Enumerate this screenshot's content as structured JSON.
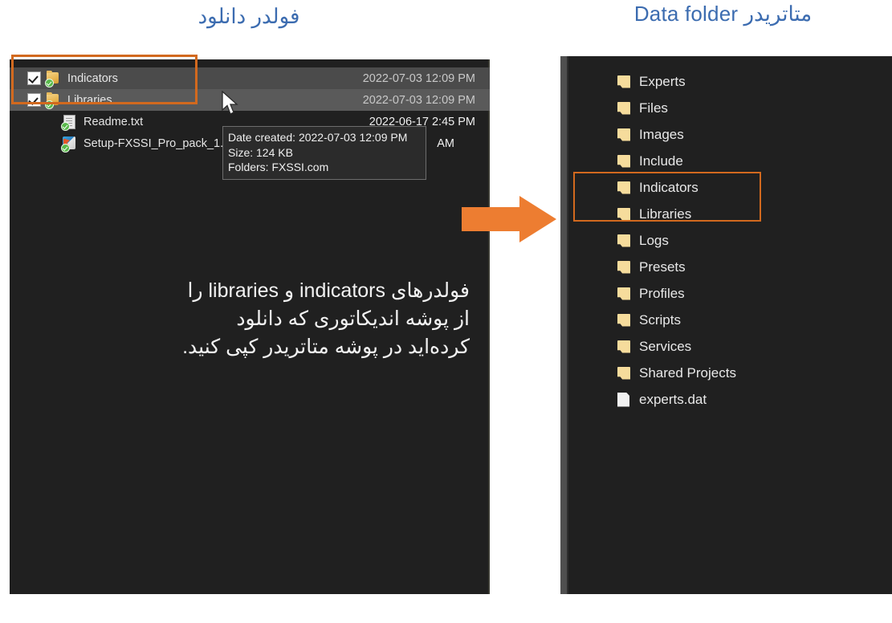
{
  "headings": {
    "left": "فولدر دانلود",
    "right": "متاتریدر Data folder"
  },
  "colors": {
    "heading_blue": "#3c6cb0",
    "highlight_orange": "#d2691e",
    "arrow_orange": "#ed7d31",
    "panel_background": "#202020",
    "folder_yellow": "#f6dc9c"
  },
  "download_folder": {
    "rows": [
      {
        "name": "Indicators",
        "date": "2022-07-03 12:09 PM",
        "icon": "folder-icon",
        "checked": true,
        "selected": "strong"
      },
      {
        "name": "Libraries",
        "date": "2022-07-03 12:09 PM",
        "icon": "folder-icon",
        "checked": true,
        "selected": "light"
      },
      {
        "name": "Readme.txt",
        "date": "2022-06-17 2:45 PM",
        "icon": "text-file-icon",
        "checked": false,
        "selected": "none"
      },
      {
        "name": "Setup-FXSSI_Pro_pack_1.086.e",
        "date": "AM",
        "icon": "setup-exe-icon",
        "checked": false,
        "selected": "none"
      }
    ],
    "tooltip": {
      "date_created": "Date created: 2022-07-03 12:09 PM",
      "size": "Size: 124 KB",
      "folders": "Folders: FXSSI.com"
    }
  },
  "metatrader_data_folder": {
    "items": [
      {
        "name": "Experts",
        "icon": "folder-icon",
        "highlighted": false
      },
      {
        "name": "Files",
        "icon": "folder-icon",
        "highlighted": false
      },
      {
        "name": "Images",
        "icon": "folder-icon",
        "highlighted": false
      },
      {
        "name": "Include",
        "icon": "folder-icon",
        "highlighted": false
      },
      {
        "name": "Indicators",
        "icon": "folder-icon",
        "highlighted": true
      },
      {
        "name": "Libraries",
        "icon": "folder-icon",
        "highlighted": true
      },
      {
        "name": "Logs",
        "icon": "folder-icon",
        "highlighted": false
      },
      {
        "name": "Presets",
        "icon": "folder-icon",
        "highlighted": false
      },
      {
        "name": "Profiles",
        "icon": "folder-icon",
        "highlighted": false
      },
      {
        "name": "Scripts",
        "icon": "folder-icon",
        "highlighted": false
      },
      {
        "name": "Services",
        "icon": "folder-icon",
        "highlighted": false
      },
      {
        "name": "Shared Projects",
        "icon": "folder-icon",
        "highlighted": false
      },
      {
        "name": "experts.dat",
        "icon": "file-icon",
        "highlighted": false
      }
    ]
  },
  "instruction": {
    "line1": "فولدرهای indicators و libraries را",
    "line2": "از پوشه اندیکاتوری که دانلود",
    "line3": "کرده‌اید در پوشه متاتریدر کپی کنید."
  },
  "arrow": {
    "direction": "right",
    "label": "copy-direction-arrow"
  }
}
